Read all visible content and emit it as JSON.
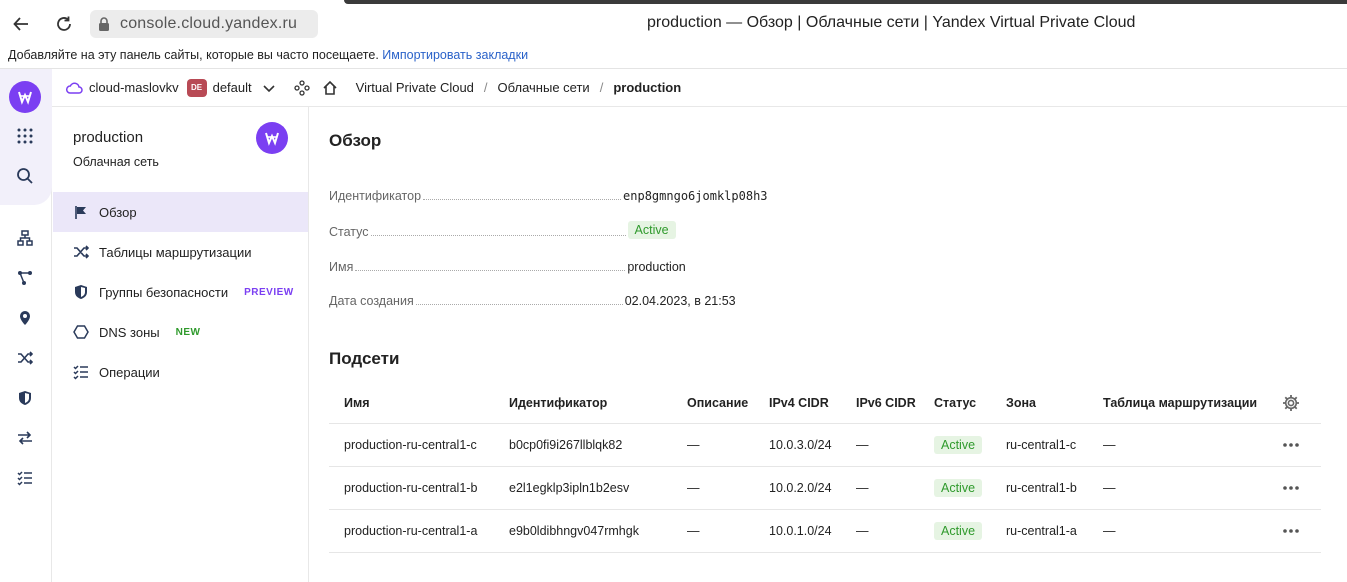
{
  "browser": {
    "url": "console.cloud.yandex.ru",
    "page_title": "production — Обзор | Облачные сети | Yandex Virtual Private Cloud",
    "bookmarks_hint": "Добавляйте на эту панель сайты, которые вы часто посещаете.",
    "bookmarks_link": "Импортировать закладки"
  },
  "header": {
    "cloud": "cloud-maslovkv",
    "folder_badge": "DE",
    "folder": "default",
    "crumbs": [
      "Virtual Private Cloud",
      "Облачные сети",
      "production"
    ]
  },
  "service_nav": {
    "title": "production",
    "subtitle": "Облачная сеть",
    "items": [
      {
        "label": "Обзор",
        "icon": "flag-icon"
      },
      {
        "label": "Таблицы маршрутизации",
        "icon": "shuffle-icon"
      },
      {
        "label": "Группы безопасности",
        "icon": "shield-icon",
        "badge": "PREVIEW",
        "badge_color": "#7b3ff2"
      },
      {
        "label": "DNS зоны",
        "icon": "hexagon-icon",
        "badge": "NEW",
        "badge_color": "#2f9a2c"
      },
      {
        "label": "Операции",
        "icon": "list-check-icon"
      }
    ]
  },
  "overview": {
    "title": "Обзор",
    "fields": [
      {
        "label": "Идентификатор",
        "value": "enp8gmngo6jomklp08h3"
      },
      {
        "label": "Статус",
        "value": "Active"
      },
      {
        "label": "Имя",
        "value": "production"
      },
      {
        "label": "Дата создания",
        "value": "02.04.2023, в 21:53"
      }
    ]
  },
  "subnets": {
    "title": "Подсети",
    "columns": [
      "Имя",
      "Идентификатор",
      "Описание",
      "IPv4 CIDR",
      "IPv6 CIDR",
      "Статус",
      "Зона",
      "Таблица маршрутизации"
    ],
    "rows": [
      [
        "production-ru-central1-c",
        "b0cp0fi9i267llblqk82",
        "—",
        "10.0.3.0/24",
        "—",
        "Active",
        "ru-central1-c",
        "—"
      ],
      [
        "production-ru-central1-b",
        "e2l1egklp3ipln1b2esv",
        "—",
        "10.0.2.0/24",
        "—",
        "Active",
        "ru-central1-b",
        "—"
      ],
      [
        "production-ru-central1-a",
        "e9b0ldibhngv047rmhgk",
        "—",
        "10.0.1.0/24",
        "—",
        "Active",
        "ru-central1-a",
        "—"
      ]
    ]
  },
  "colors": {
    "accent": "#7b3ff2",
    "active_bg": "#e6f4e3",
    "active_fg": "#2f9a2c",
    "folder": "#b84a55"
  }
}
